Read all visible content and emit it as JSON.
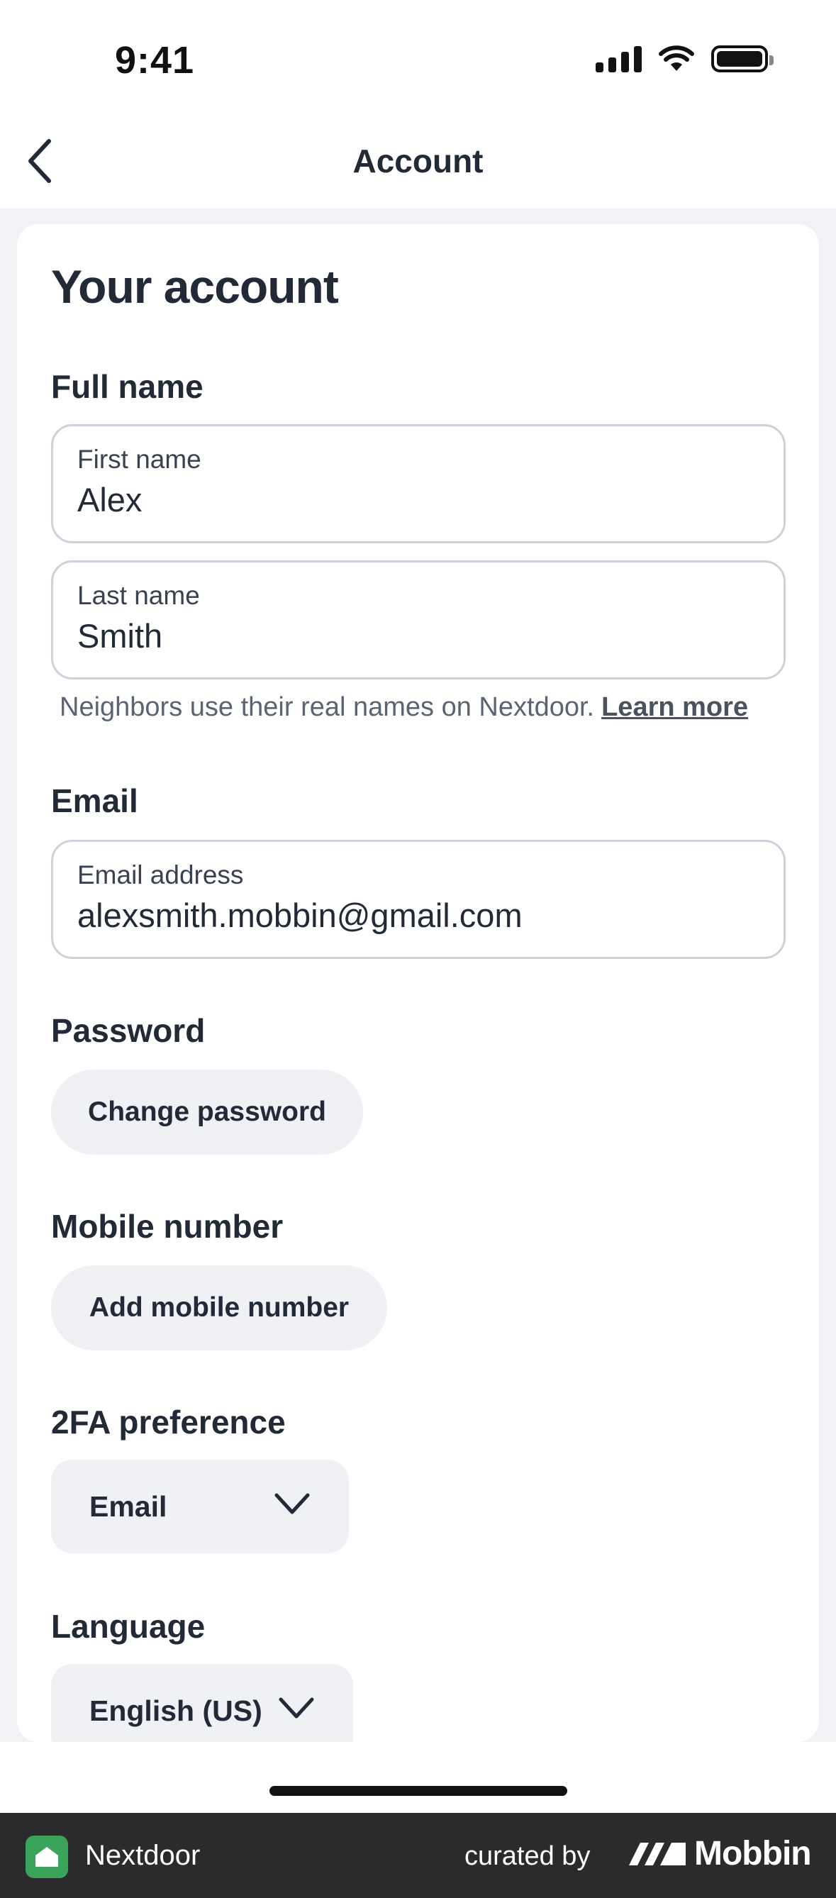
{
  "status_bar": {
    "time": "9:41"
  },
  "nav": {
    "title": "Account"
  },
  "page": {
    "title": "Your account"
  },
  "full_name": {
    "label": "Full name",
    "first": {
      "label": "First name",
      "value": "Alex"
    },
    "last": {
      "label": "Last name",
      "value": "Smith"
    },
    "helper": "Neighbors use their real names on Nextdoor.",
    "learn_more": "Learn more"
  },
  "email": {
    "label": "Email",
    "field_label": "Email address",
    "value": "alexsmith.mobbin@gmail.com"
  },
  "password": {
    "label": "Password",
    "button": "Change password"
  },
  "mobile": {
    "label": "Mobile number",
    "button": "Add mobile number"
  },
  "twofa": {
    "label": "2FA preference",
    "selected": "Email"
  },
  "language": {
    "label": "Language",
    "selected": "English (US)"
  },
  "footer": {
    "app_name": "Nextdoor",
    "curated_by": "curated by",
    "brand": "Mobbin"
  },
  "colors": {
    "text": "#232a37",
    "field_border": "#cdd2da",
    "pill_bg": "#eff1f5",
    "page_bg": "#f0f2f5",
    "footer_bg": "#2b2b2d",
    "nextdoor_green": "#3aa55a"
  }
}
